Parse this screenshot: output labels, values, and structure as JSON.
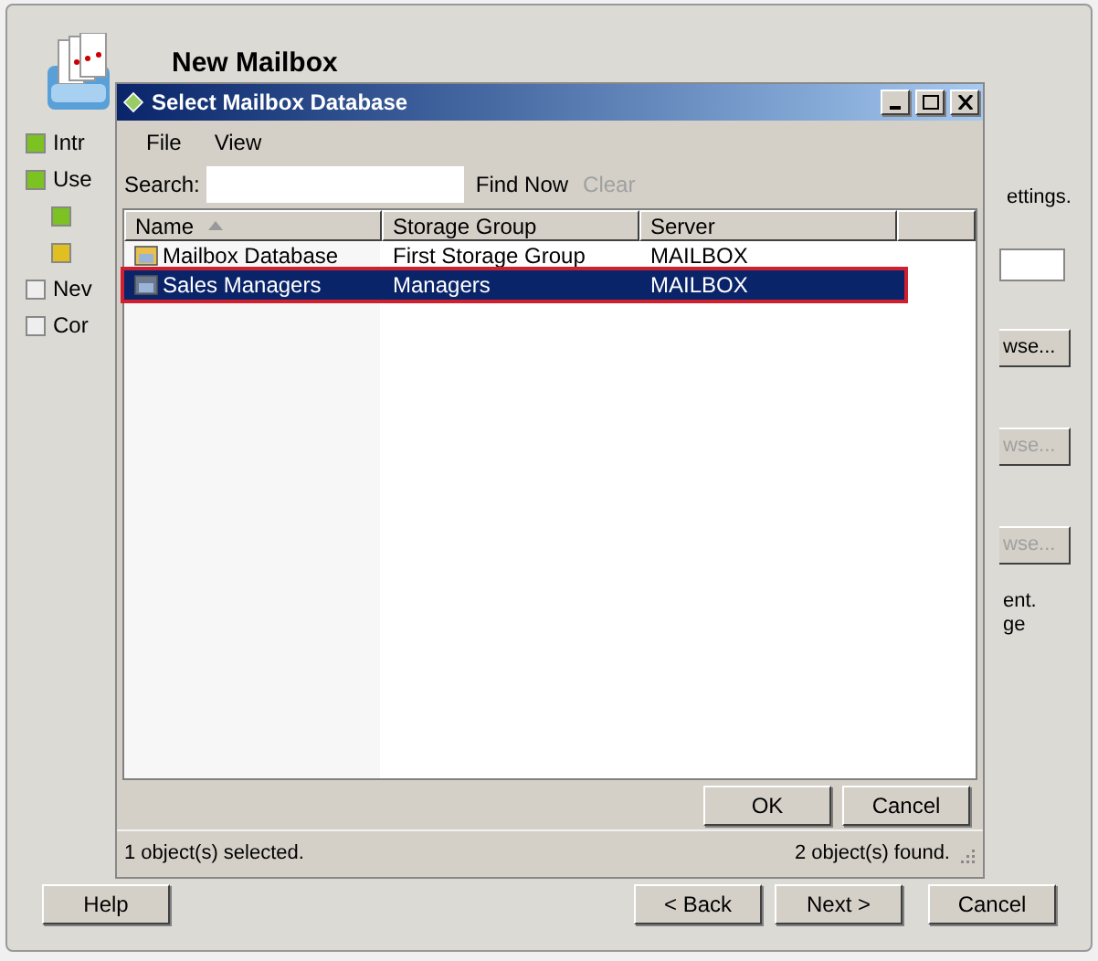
{
  "wizard": {
    "title": "New Mailbox",
    "steps": [
      {
        "label": "Intr",
        "color": "#7cc222"
      },
      {
        "label": "Use",
        "color": "#7cc222",
        "children": [
          {
            "color": "#7cc222"
          },
          {
            "color": "#e0c020"
          }
        ]
      },
      {
        "label": "Nev",
        "color": "#eeeeee"
      },
      {
        "label": "Cor",
        "color": "#eeeeee"
      }
    ],
    "right_texts": [
      "ettings."
    ],
    "browse_buttons": [
      {
        "label": "wse...",
        "disabled": false
      },
      {
        "label": "wse...",
        "disabled": true
      },
      {
        "label": "wse...",
        "disabled": true
      }
    ],
    "note_lines": [
      "ent.",
      "ge"
    ],
    "buttons": [
      {
        "label": "Help",
        "kind": "left"
      },
      {
        "label": "< Back",
        "kind": "right"
      },
      {
        "label": "Next >",
        "kind": "right"
      },
      {
        "label": "Cancel",
        "kind": "right"
      }
    ]
  },
  "dialog": {
    "title": "Select Mailbox Database",
    "menu": [
      "File",
      "View"
    ],
    "search": {
      "label": "Search:",
      "find_now": "Find Now",
      "clear": "Clear",
      "clear_disabled": true
    },
    "columns": [
      {
        "label": "Name",
        "sorted": true
      },
      {
        "label": "Storage Group",
        "sorted": false
      },
      {
        "label": "Server",
        "sorted": false
      }
    ],
    "rows": [
      {
        "cells": [
          "Mailbox Database",
          "First Storage Group",
          "MAILBOX"
        ],
        "selected": false,
        "kind": "database"
      },
      {
        "cells": [
          "Sales Managers",
          "Managers",
          "MAILBOX"
        ],
        "selected": true,
        "kind": "database-grey"
      }
    ],
    "buttons": [
      "OK",
      "Cancel"
    ],
    "status_left": "1 object(s) selected.",
    "status_right": "2 object(s) found."
  }
}
